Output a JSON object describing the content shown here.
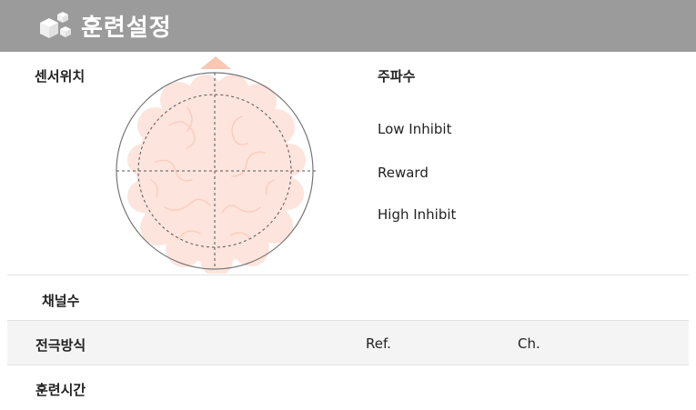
{
  "header": {
    "title": "훈련설정",
    "icon": "cubes-icon"
  },
  "sensor": {
    "label": "센서위치"
  },
  "frequency": {
    "label": "주파수",
    "items": [
      "Low Inhibit",
      "Reward",
      "High Inhibit"
    ]
  },
  "channels": {
    "label": "채널수"
  },
  "electrode": {
    "label": "전극방식",
    "ref_label": "Ref.",
    "ch_label": "Ch."
  },
  "training_time": {
    "label": "훈련시간"
  },
  "colors": {
    "header_bg": "#9b9b9b",
    "brain_fill": "#fde4dc",
    "nose_fill": "#f9c7b4"
  }
}
